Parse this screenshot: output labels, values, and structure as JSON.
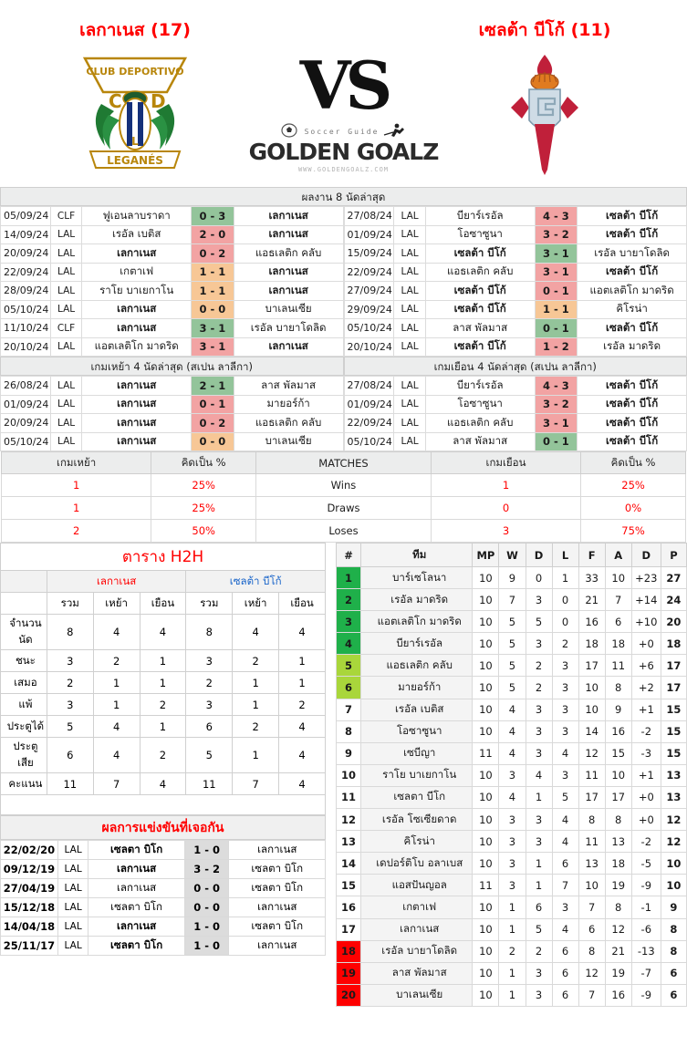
{
  "header": {
    "home_team": "เลกาเนส (17)",
    "away_team": "เซลต้า บีโก้ (11)",
    "vs": "VS",
    "brand_sub": "Soccer Guide",
    "brand_main": "GOLDEN GOALZ",
    "brand_url": "WWW.GOLDENGOALZ.COM"
  },
  "recent": {
    "home_title": "ผลงาน 8 นัดล่าสุด",
    "away_title": "",
    "home_rows": [
      {
        "date": "05/09/24",
        "comp": "CLF",
        "home": "ฟูเอนลาบราดา",
        "score": "0 - 3",
        "away": "เลกาเนส",
        "result": "win",
        "bold_home": false,
        "bold_away": true
      },
      {
        "date": "14/09/24",
        "comp": "LAL",
        "home": "เรอัล เบติส",
        "score": "2 - 0",
        "away": "เลกาเนส",
        "result": "loss",
        "bold_home": false,
        "bold_away": true
      },
      {
        "date": "20/09/24",
        "comp": "LAL",
        "home": "เลกาเนส",
        "score": "0 - 2",
        "away": "แอธเลติก คลับ",
        "result": "loss",
        "bold_home": true,
        "bold_away": false
      },
      {
        "date": "22/09/24",
        "comp": "LAL",
        "home": "เกตาเฟ",
        "score": "1 - 1",
        "away": "เลกาเนส",
        "result": "draw",
        "bold_home": false,
        "bold_away": true
      },
      {
        "date": "28/09/24",
        "comp": "LAL",
        "home": "ราโย บาเยกาโน",
        "score": "1 - 1",
        "away": "เลกาเนส",
        "result": "draw",
        "bold_home": false,
        "bold_away": true
      },
      {
        "date": "05/10/24",
        "comp": "LAL",
        "home": "เลกาเนส",
        "score": "0 - 0",
        "away": "บาเลนเซีย",
        "result": "draw",
        "bold_home": true,
        "bold_away": false
      },
      {
        "date": "11/10/24",
        "comp": "CLF",
        "home": "เลกาเนส",
        "score": "3 - 1",
        "away": "เรอัล บายาโดลิด",
        "result": "win",
        "bold_home": true,
        "bold_away": false
      },
      {
        "date": "20/10/24",
        "comp": "LAL",
        "home": "แอตเลติโก มาดริด",
        "score": "3 - 1",
        "away": "เลกาเนส",
        "result": "loss",
        "bold_home": false,
        "bold_away": true
      }
    ],
    "away_rows": [
      {
        "date": "27/08/24",
        "comp": "LAL",
        "home": "บียาร์เรอัล",
        "score": "4 - 3",
        "away": "เซลต้า บีโก้",
        "result": "loss",
        "bold_home": false,
        "bold_away": true
      },
      {
        "date": "01/09/24",
        "comp": "LAL",
        "home": "โอซาซูนา",
        "score": "3 - 2",
        "away": "เซลต้า บีโก้",
        "result": "loss",
        "bold_home": false,
        "bold_away": true
      },
      {
        "date": "15/09/24",
        "comp": "LAL",
        "home": "เซลต้า บีโก้",
        "score": "3 - 1",
        "away": "เรอัล บายาโดลิด",
        "result": "win",
        "bold_home": true,
        "bold_away": false
      },
      {
        "date": "22/09/24",
        "comp": "LAL",
        "home": "แอธเลติก คลับ",
        "score": "3 - 1",
        "away": "เซลต้า บีโก้",
        "result": "loss",
        "bold_home": false,
        "bold_away": true
      },
      {
        "date": "27/09/24",
        "comp": "LAL",
        "home": "เซลต้า บีโก้",
        "score": "0 - 1",
        "away": "แอตเลติโก มาดริด",
        "result": "loss",
        "bold_home": true,
        "bold_away": false
      },
      {
        "date": "29/09/24",
        "comp": "LAL",
        "home": "เซลต้า บีโก้",
        "score": "1 - 1",
        "away": "คิโรน่า",
        "result": "draw",
        "bold_home": true,
        "bold_away": false
      },
      {
        "date": "05/10/24",
        "comp": "LAL",
        "home": "ลาส พัลมาส",
        "score": "0 - 1",
        "away": "เซลต้า บีโก้",
        "result": "win",
        "bold_home": false,
        "bold_away": true
      },
      {
        "date": "20/10/24",
        "comp": "LAL",
        "home": "เซลต้า บีโก้",
        "score": "1 - 2",
        "away": "เรอัล มาดริด",
        "result": "loss",
        "bold_home": true,
        "bold_away": false
      }
    ]
  },
  "venue": {
    "home_title": "เกมเหย้า 4 นัดล่าสุด (สเปน ลาลีกา)",
    "away_title": "เกมเยือน 4 นัดล่าสุด (สเปน ลาลีกา)",
    "home_rows": [
      {
        "date": "26/08/24",
        "comp": "LAL",
        "home": "เลกาเนส",
        "score": "2 - 1",
        "away": "ลาส พัลมาส",
        "result": "win",
        "bold_home": true,
        "bold_away": false
      },
      {
        "date": "01/09/24",
        "comp": "LAL",
        "home": "เลกาเนส",
        "score": "0 - 1",
        "away": "มายอร์ก้า",
        "result": "loss",
        "bold_home": true,
        "bold_away": false
      },
      {
        "date": "20/09/24",
        "comp": "LAL",
        "home": "เลกาเนส",
        "score": "0 - 2",
        "away": "แอธเลติก คลับ",
        "result": "loss",
        "bold_home": true,
        "bold_away": false
      },
      {
        "date": "05/10/24",
        "comp": "LAL",
        "home": "เลกาเนส",
        "score": "0 - 0",
        "away": "บาเลนเซีย",
        "result": "draw",
        "bold_home": true,
        "bold_away": false
      }
    ],
    "away_rows": [
      {
        "date": "27/08/24",
        "comp": "LAL",
        "home": "บียาร์เรอัล",
        "score": "4 - 3",
        "away": "เซลต้า บีโก้",
        "result": "loss",
        "bold_home": false,
        "bold_away": true
      },
      {
        "date": "01/09/24",
        "comp": "LAL",
        "home": "โอซาซูนา",
        "score": "3 - 2",
        "away": "เซลต้า บีโก้",
        "result": "loss",
        "bold_home": false,
        "bold_away": true
      },
      {
        "date": "22/09/24",
        "comp": "LAL",
        "home": "แอธเลติก คลับ",
        "score": "3 - 1",
        "away": "เซลต้า บีโก้",
        "result": "loss",
        "bold_home": false,
        "bold_away": true
      },
      {
        "date": "05/10/24",
        "comp": "LAL",
        "home": "ลาส พัลมาส",
        "score": "0 - 1",
        "away": "เซลต้า บีโก้",
        "result": "win",
        "bold_home": false,
        "bold_away": true
      }
    ]
  },
  "stats": {
    "headers": [
      "เกมเหย้า",
      "คิดเป็น %",
      "MATCHES",
      "เกมเยือน",
      "คิดเป็น %"
    ],
    "rows": [
      {
        "home": "1",
        "home_pct": "25%",
        "label": "Wins",
        "away": "1",
        "away_pct": "25%"
      },
      {
        "home": "1",
        "home_pct": "25%",
        "label": "Draws",
        "away": "0",
        "away_pct": "0%"
      },
      {
        "home": "2",
        "home_pct": "50%",
        "label": "Loses",
        "away": "3",
        "away_pct": "75%"
      }
    ]
  },
  "h2h": {
    "title": "ตาราง H2H",
    "team_a": "เลกาเนส",
    "team_b": "เซลต้า บีโก้",
    "subheaders": [
      "รวม",
      "เหย้า",
      "เยือน",
      "รวม",
      "เหย้า",
      "เยือน"
    ],
    "rows": [
      {
        "label": "จำนวนนัด",
        "values": [
          "8",
          "4",
          "4",
          "8",
          "4",
          "4"
        ]
      },
      {
        "label": "ชนะ",
        "values": [
          "3",
          "2",
          "1",
          "3",
          "2",
          "1"
        ]
      },
      {
        "label": "เสมอ",
        "values": [
          "2",
          "1",
          "1",
          "2",
          "1",
          "1"
        ]
      },
      {
        "label": "แพ้",
        "values": [
          "3",
          "1",
          "2",
          "3",
          "1",
          "2"
        ]
      },
      {
        "label": "ประตูได้",
        "values": [
          "5",
          "4",
          "1",
          "6",
          "2",
          "4"
        ]
      },
      {
        "label": "ประตูเสีย",
        "values": [
          "6",
          "4",
          "2",
          "5",
          "1",
          "4"
        ]
      },
      {
        "label": "คะแนน",
        "values": [
          "11",
          "7",
          "4",
          "11",
          "7",
          "4"
        ]
      }
    ]
  },
  "past_results": {
    "title": "ผลการแข่งขันที่เจอกัน",
    "rows": [
      {
        "date": "22/02/20",
        "comp": "LAL",
        "home": "เซลตา บิโก",
        "score": "1 - 0",
        "away": "เลกาเนส",
        "bold_home": true,
        "bold_away": false
      },
      {
        "date": "09/12/19",
        "comp": "LAL",
        "home": "เลกาเนส",
        "score": "3 - 2",
        "away": "เซลตา บิโก",
        "bold_home": true,
        "bold_away": false
      },
      {
        "date": "27/04/19",
        "comp": "LAL",
        "home": "เลกาเนส",
        "score": "0 - 0",
        "away": "เซลตา บิโก",
        "bold_home": false,
        "bold_away": false
      },
      {
        "date": "15/12/18",
        "comp": "LAL",
        "home": "เซลตา บิโก",
        "score": "0 - 0",
        "away": "เลกาเนส",
        "bold_home": false,
        "bold_away": false
      },
      {
        "date": "14/04/18",
        "comp": "LAL",
        "home": "เลกาเนส",
        "score": "1 - 0",
        "away": "เซลตา บิโก",
        "bold_home": true,
        "bold_away": false
      },
      {
        "date": "25/11/17",
        "comp": "LAL",
        "home": "เซลตา บิโก",
        "score": "1 - 0",
        "away": "เลกาเนส",
        "bold_home": true,
        "bold_away": false
      }
    ]
  },
  "standings": {
    "headers": [
      "#",
      "ทีม",
      "MP",
      "W",
      "D",
      "L",
      "F",
      "A",
      "D",
      "P"
    ],
    "rows": [
      {
        "rank": "1",
        "team": "บาร์เซโลนา",
        "mp": "10",
        "w": "9",
        "d": "0",
        "l": "1",
        "f": "33",
        "a": "10",
        "gd": "+23",
        "p": "27",
        "zone": "ucl"
      },
      {
        "rank": "2",
        "team": "เรอัล มาดริด",
        "mp": "10",
        "w": "7",
        "d": "3",
        "l": "0",
        "f": "21",
        "a": "7",
        "gd": "+14",
        "p": "24",
        "zone": "ucl"
      },
      {
        "rank": "3",
        "team": "แอตเลติโก มาดริด",
        "mp": "10",
        "w": "5",
        "d": "5",
        "l": "0",
        "f": "16",
        "a": "6",
        "gd": "+10",
        "p": "20",
        "zone": "ucl"
      },
      {
        "rank": "4",
        "team": "บียาร์เรอัล",
        "mp": "10",
        "w": "5",
        "d": "3",
        "l": "2",
        "f": "18",
        "a": "18",
        "gd": "+0",
        "p": "18",
        "zone": "ucl"
      },
      {
        "rank": "5",
        "team": "แอธเลติก คลับ",
        "mp": "10",
        "w": "5",
        "d": "2",
        "l": "3",
        "f": "17",
        "a": "11",
        "gd": "+6",
        "p": "17",
        "zone": "uel"
      },
      {
        "rank": "6",
        "team": "มายอร์ก้า",
        "mp": "10",
        "w": "5",
        "d": "2",
        "l": "3",
        "f": "10",
        "a": "8",
        "gd": "+2",
        "p": "17",
        "zone": "uel"
      },
      {
        "rank": "7",
        "team": "เรอัล เบติส",
        "mp": "10",
        "w": "4",
        "d": "3",
        "l": "3",
        "f": "10",
        "a": "9",
        "gd": "+1",
        "p": "15",
        "zone": "none"
      },
      {
        "rank": "8",
        "team": "โอซาซูนา",
        "mp": "10",
        "w": "4",
        "d": "3",
        "l": "3",
        "f": "14",
        "a": "16",
        "gd": "-2",
        "p": "15",
        "zone": "none"
      },
      {
        "rank": "9",
        "team": "เซบีญา",
        "mp": "11",
        "w": "4",
        "d": "3",
        "l": "4",
        "f": "12",
        "a": "15",
        "gd": "-3",
        "p": "15",
        "zone": "none"
      },
      {
        "rank": "10",
        "team": "ราโย บาเยกาโน",
        "mp": "10",
        "w": "3",
        "d": "4",
        "l": "3",
        "f": "11",
        "a": "10",
        "gd": "+1",
        "p": "13",
        "zone": "none"
      },
      {
        "rank": "11",
        "team": "เซลตา บีโก",
        "mp": "10",
        "w": "4",
        "d": "1",
        "l": "5",
        "f": "17",
        "a": "17",
        "gd": "+0",
        "p": "13",
        "zone": "none"
      },
      {
        "rank": "12",
        "team": "เรอัล โซเซียดาด",
        "mp": "10",
        "w": "3",
        "d": "3",
        "l": "4",
        "f": "8",
        "a": "8",
        "gd": "+0",
        "p": "12",
        "zone": "none"
      },
      {
        "rank": "13",
        "team": "คิโรน่า",
        "mp": "10",
        "w": "3",
        "d": "3",
        "l": "4",
        "f": "11",
        "a": "13",
        "gd": "-2",
        "p": "12",
        "zone": "none"
      },
      {
        "rank": "14",
        "team": "เดปอร์ติโบ อลาเบส",
        "mp": "10",
        "w": "3",
        "d": "1",
        "l": "6",
        "f": "13",
        "a": "18",
        "gd": "-5",
        "p": "10",
        "zone": "none"
      },
      {
        "rank": "15",
        "team": "แอสปันญอล",
        "mp": "11",
        "w": "3",
        "d": "1",
        "l": "7",
        "f": "10",
        "a": "19",
        "gd": "-9",
        "p": "10",
        "zone": "none"
      },
      {
        "rank": "16",
        "team": "เกตาเฟ",
        "mp": "10",
        "w": "1",
        "d": "6",
        "l": "3",
        "f": "7",
        "a": "8",
        "gd": "-1",
        "p": "9",
        "zone": "none"
      },
      {
        "rank": "17",
        "team": "เลกาเนส",
        "mp": "10",
        "w": "1",
        "d": "5",
        "l": "4",
        "f": "6",
        "a": "12",
        "gd": "-6",
        "p": "8",
        "zone": "none"
      },
      {
        "rank": "18",
        "team": "เรอัล บายาโดลิด",
        "mp": "10",
        "w": "2",
        "d": "2",
        "l": "6",
        "f": "8",
        "a": "21",
        "gd": "-13",
        "p": "8",
        "zone": "rel"
      },
      {
        "rank": "19",
        "team": "ลาส พัลมาส",
        "mp": "10",
        "w": "1",
        "d": "3",
        "l": "6",
        "f": "12",
        "a": "19",
        "gd": "-7",
        "p": "6",
        "zone": "rel"
      },
      {
        "rank": "20",
        "team": "บาเลนเซีย",
        "mp": "10",
        "w": "1",
        "d": "3",
        "l": "6",
        "f": "7",
        "a": "16",
        "gd": "-9",
        "p": "6",
        "zone": "rel"
      }
    ]
  }
}
